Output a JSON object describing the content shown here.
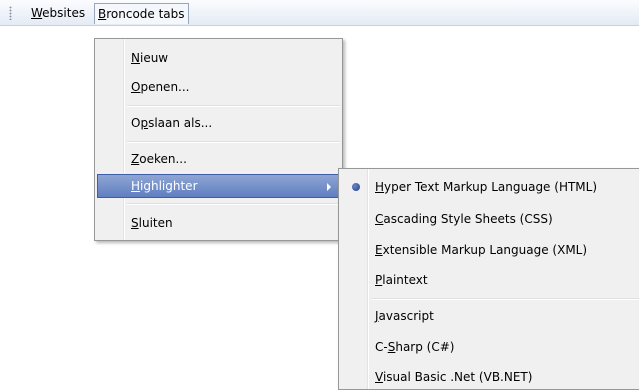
{
  "menubar": {
    "items": [
      {
        "label": "Websites",
        "mnemonic": "W",
        "rest": "ebsites"
      },
      {
        "label": "Broncode tabs",
        "mnemonic": "B",
        "rest": "roncode tabs"
      }
    ]
  },
  "file_menu": {
    "items": [
      {
        "pre": "",
        "mn": "N",
        "post": "ieuw"
      },
      {
        "pre": "",
        "mn": "O",
        "post": "penen..."
      },
      {
        "pre": "O",
        "mn": "p",
        "post": "slaan als..."
      },
      {
        "pre": "",
        "mn": "Z",
        "post": "oeken..."
      },
      {
        "pre": "",
        "mn": "H",
        "post": "ighlighter"
      },
      {
        "pre": "",
        "mn": "S",
        "post": "luiten"
      }
    ]
  },
  "highlighter_menu": {
    "selected_index": 0,
    "items": [
      {
        "pre": "",
        "mn": "H",
        "post": "yper Text Markup Language (HTML)"
      },
      {
        "pre": "",
        "mn": "C",
        "post": "ascading Style Sheets (CSS)"
      },
      {
        "pre": "",
        "mn": "E",
        "post": "xtensible Markup Language (XML)"
      },
      {
        "pre": "",
        "mn": "P",
        "post": "laintext"
      },
      {
        "pre": "",
        "mn": "J",
        "post": "avascript"
      },
      {
        "pre": "C-",
        "mn": "S",
        "post": "harp (C#)"
      },
      {
        "pre": "",
        "mn": "V",
        "post": "isual Basic .Net (VB.NET)"
      }
    ]
  },
  "colors": {
    "highlight": "#6685c5",
    "menu_bg": "#f0f0f0",
    "menubar_bg": "#e4ebf5"
  }
}
